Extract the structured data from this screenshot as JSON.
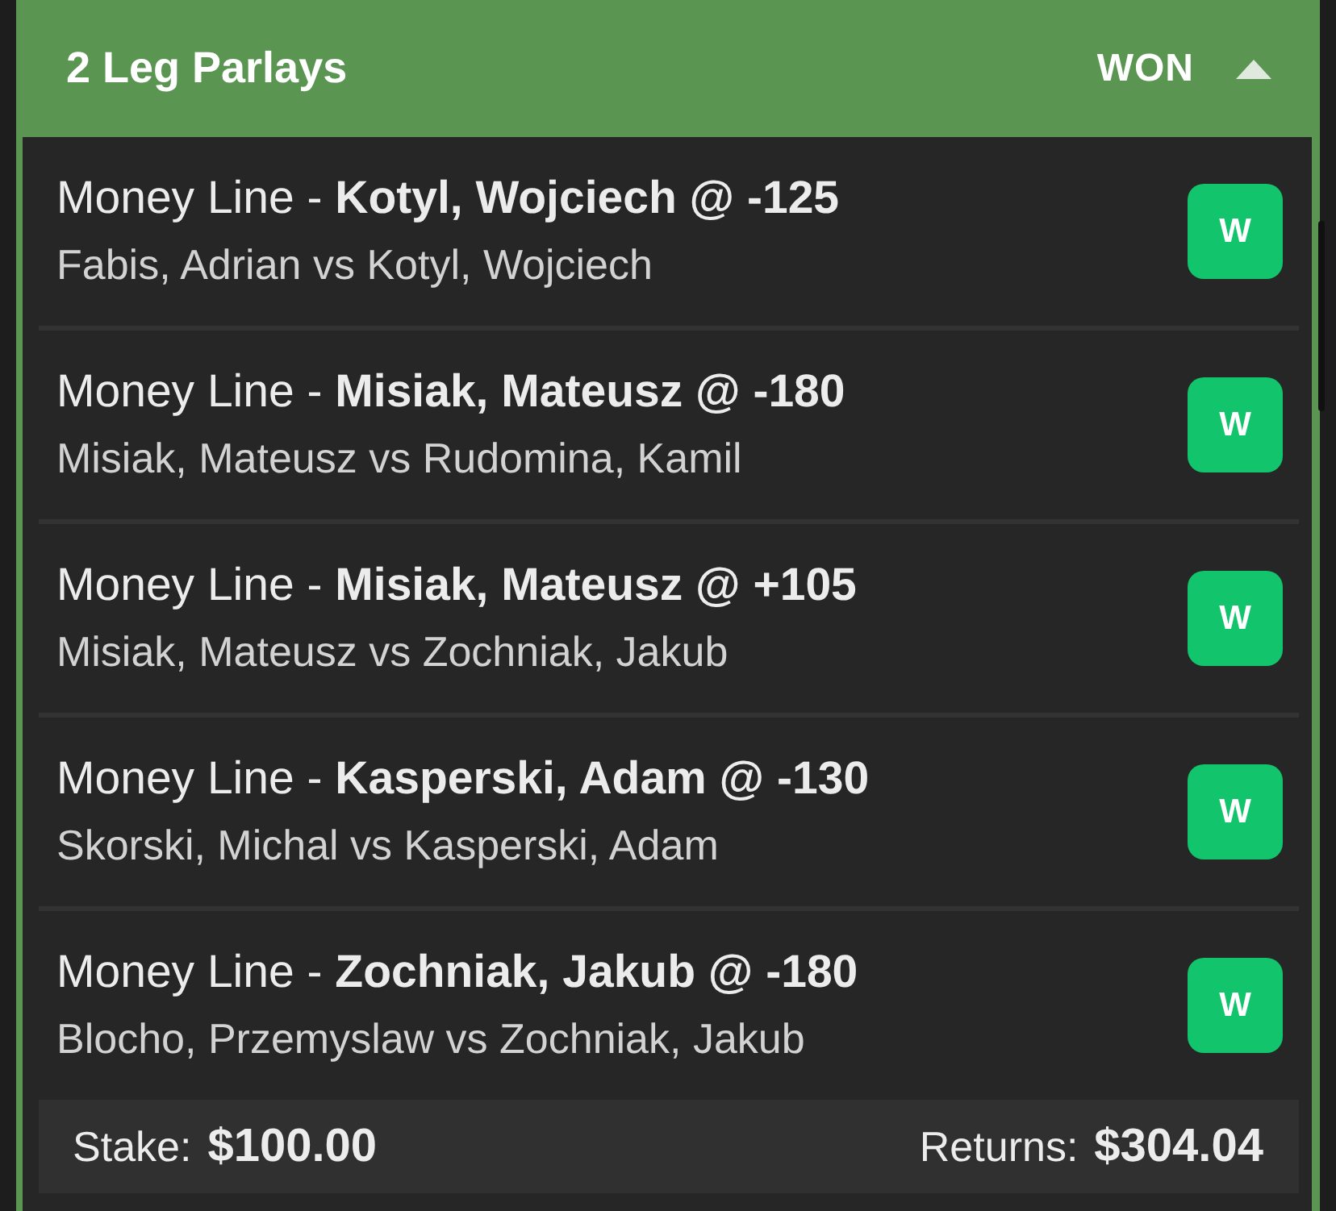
{
  "header": {
    "title": "2 Leg Parlays",
    "status": "WON",
    "expanded": true
  },
  "legs": [
    {
      "pick": "Money Line - **Kotyl, Wojciech @ -125**",
      "matchup": "Fabis, Adrian vs Kotyl, Wojciech",
      "result": "W"
    },
    {
      "pick": "Money Line - **Misiak, Mateusz @ -180**",
      "matchup": "Misiak, Mateusz vs Rudomina, Kamil",
      "result": "W"
    },
    {
      "pick": "Money Line - **Misiak, Mateusz @ +105**",
      "matchup": "Misiak, Mateusz vs Zochniak, Jakub",
      "result": "W"
    },
    {
      "pick": "Money Line - **Kasperski, Adam @ -130**",
      "matchup": "Skorski, Michal vs Kasperski, Adam",
      "result": "W"
    },
    {
      "pick": "Money Line - **Zochniak, Jakub @ -180**",
      "matchup": "Blocho, Przemyslaw vs Zochniak, Jakub",
      "result": "W"
    }
  ],
  "footer": {
    "stake_label": "Stake:",
    "stake": "$100.00",
    "returns_label": "Returns:",
    "returns": "$304.04"
  }
}
